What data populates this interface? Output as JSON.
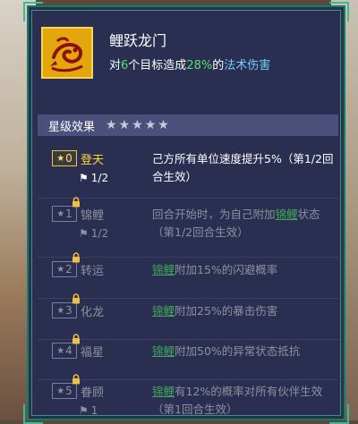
{
  "skill": {
    "name": "鲤跃龙门",
    "desc_prefix": "对",
    "target_count": "6",
    "desc_mid": "个目标造成",
    "damage_percent": "28%",
    "desc_of": "的",
    "damage_type": "法术伤害"
  },
  "star_section": {
    "title": "星级效果",
    "stars": 5
  },
  "tiers": [
    {
      "level": "0",
      "name": "登天",
      "progress": "1/2",
      "state": "active",
      "effect": [
        "己方所有单位速度提升5%（第1/2回合生效）"
      ]
    },
    {
      "level": "1",
      "name": "锦鲤",
      "progress": "1/2",
      "state": "locked",
      "effect": [
        "回合开始时，为自己附加",
        "锦鲤",
        "状态（第1/2回合生效）"
      ]
    },
    {
      "level": "2",
      "name": "转运",
      "progress": "",
      "state": "locked",
      "effect": [
        "",
        "锦鲤",
        "附加15%的闪避概率"
      ]
    },
    {
      "level": "3",
      "name": "化龙",
      "progress": "",
      "state": "locked",
      "effect": [
        "",
        "锦鲤",
        "附加25%的暴击伤害"
      ]
    },
    {
      "level": "4",
      "name": "福星",
      "progress": "",
      "state": "locked",
      "effect": [
        "",
        "锦鲤",
        "附加50%的异常状态抵抗"
      ]
    },
    {
      "level": "5",
      "name": "眷顾",
      "progress": "1",
      "state": "locked",
      "effect": [
        "",
        "锦鲤",
        "有12%的概率对所有伙伴生效（第1回合生效）"
      ]
    }
  ],
  "colors": {
    "active": "#ffd23a",
    "highlight": "#54e06a",
    "damage_type": "#6fd0ff",
    "locked": "#8e909c"
  }
}
